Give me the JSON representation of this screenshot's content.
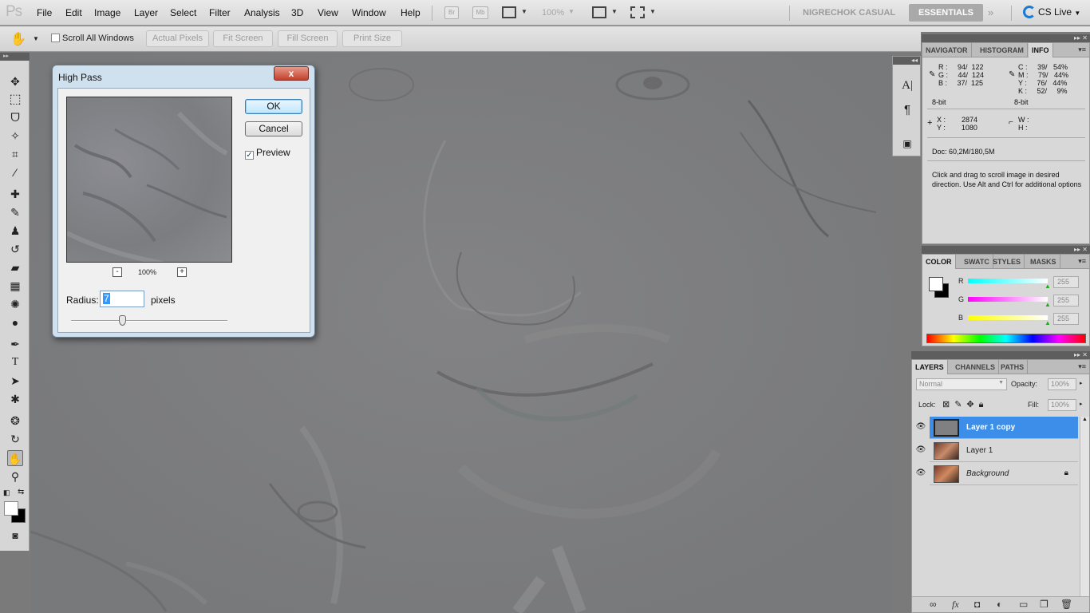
{
  "app": {
    "logo": "Ps"
  },
  "menu": [
    "File",
    "Edit",
    "Image",
    "Layer",
    "Select",
    "Filter",
    "Analysis",
    "3D",
    "View",
    "Window",
    "Help"
  ],
  "appbar": {
    "bridge_label": "Br",
    "minibridge_label": "Mb",
    "zoom": "100%",
    "workspace_inactive": "NIGRECHOK CASUAL",
    "workspace_active": "ESSENTIALS",
    "more": "»",
    "cslive": "CS Live"
  },
  "options": {
    "scroll_all": "Scroll All Windows",
    "actual_pixels": "Actual Pixels",
    "fit_screen": "Fit Screen",
    "fill_screen": "Fill Screen",
    "print_size": "Print Size"
  },
  "dialog": {
    "title": "High Pass",
    "close": "x",
    "ok": "OK",
    "cancel": "Cancel",
    "preview": "Preview",
    "preview_checked": true,
    "zoom_out": "-",
    "zoom_in": "+",
    "zoom": "100%",
    "radius_label": "Radius:",
    "radius_value": "7",
    "units": "pixels"
  },
  "info_panel": {
    "tabs": [
      "NAVIGATOR",
      "HISTOGRAM",
      "INFO"
    ],
    "active_tab": "INFO",
    "rgb_block": "R :     94/  122\nG :     44/  124\nB :     37/  125",
    "cmyk_block": "C :     39/   54%\nM :     79/   44%\nY :     76/   44%\nK :     52/     9%",
    "bit_left": "8-bit",
    "bit_right": "8-bit",
    "xy_block": "X :        2874\nY :        1080",
    "wh_block": "W :\nH :",
    "doc": "Doc: 60,2M/180,5M",
    "help": "Click and drag to scroll image in desired direction.  Use Alt and Ctrl for additional options"
  },
  "color_panel": {
    "tabs": [
      "COLOR",
      "SWATC",
      "STYLES",
      "MASKS"
    ],
    "active_tab": "COLOR",
    "r_label": "R",
    "g_label": "G",
    "b_label": "B",
    "r_value": "255",
    "g_value": "255",
    "b_value": "255"
  },
  "layers_panel": {
    "tabs": [
      "LAYERS",
      "CHANNELS",
      "PATHS"
    ],
    "active_tab": "LAYERS",
    "blend_mode": "Normal",
    "opacity_label": "Opacity:",
    "opacity": "100%",
    "lock_label": "Lock:",
    "fill_label": "Fill:",
    "fill": "100%",
    "layers": [
      {
        "name": "Layer 1 copy",
        "selected": true
      },
      {
        "name": "Layer 1",
        "selected": false
      },
      {
        "name": "Background",
        "selected": false
      }
    ]
  },
  "colors": {
    "accent": "#3d8ee8",
    "canvas": "#7e7e80"
  }
}
